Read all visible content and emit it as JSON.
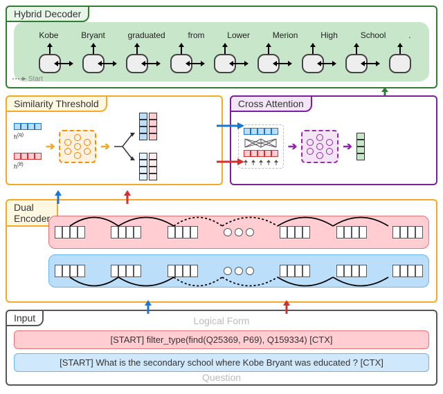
{
  "hybrid_decoder": {
    "title": "Hybrid Decoder",
    "tokens": [
      "Kobe",
      "Bryant",
      "graduated",
      "from",
      "Lower",
      "Merion",
      "High",
      "School",
      "."
    ],
    "start_label": "Start"
  },
  "similarity_threshold": {
    "title": "Similarity Threshold",
    "h_q_label": "h",
    "h_q_sup": "(q)",
    "h_lf_label": "h",
    "h_lf_sup": "(lf)"
  },
  "cross_attention": {
    "title": "Cross Attention"
  },
  "dual_encoder": {
    "title": "Dual\nEncoder"
  },
  "input": {
    "title": "Input",
    "logical_form_label": "Logical Form",
    "question_label": "Question",
    "logical_form_text": "[START] filter_type(find(Q25369, P69), Q159334) [CTX]",
    "question_text": "[START] What is the secondary school where Kobe Bryant was educated ? [CTX]"
  },
  "colors": {
    "green": "#2e7d32",
    "orange": "#f9a825",
    "purple": "#7b1fa2",
    "blue": "#1976d2",
    "red": "#d32f2f"
  }
}
